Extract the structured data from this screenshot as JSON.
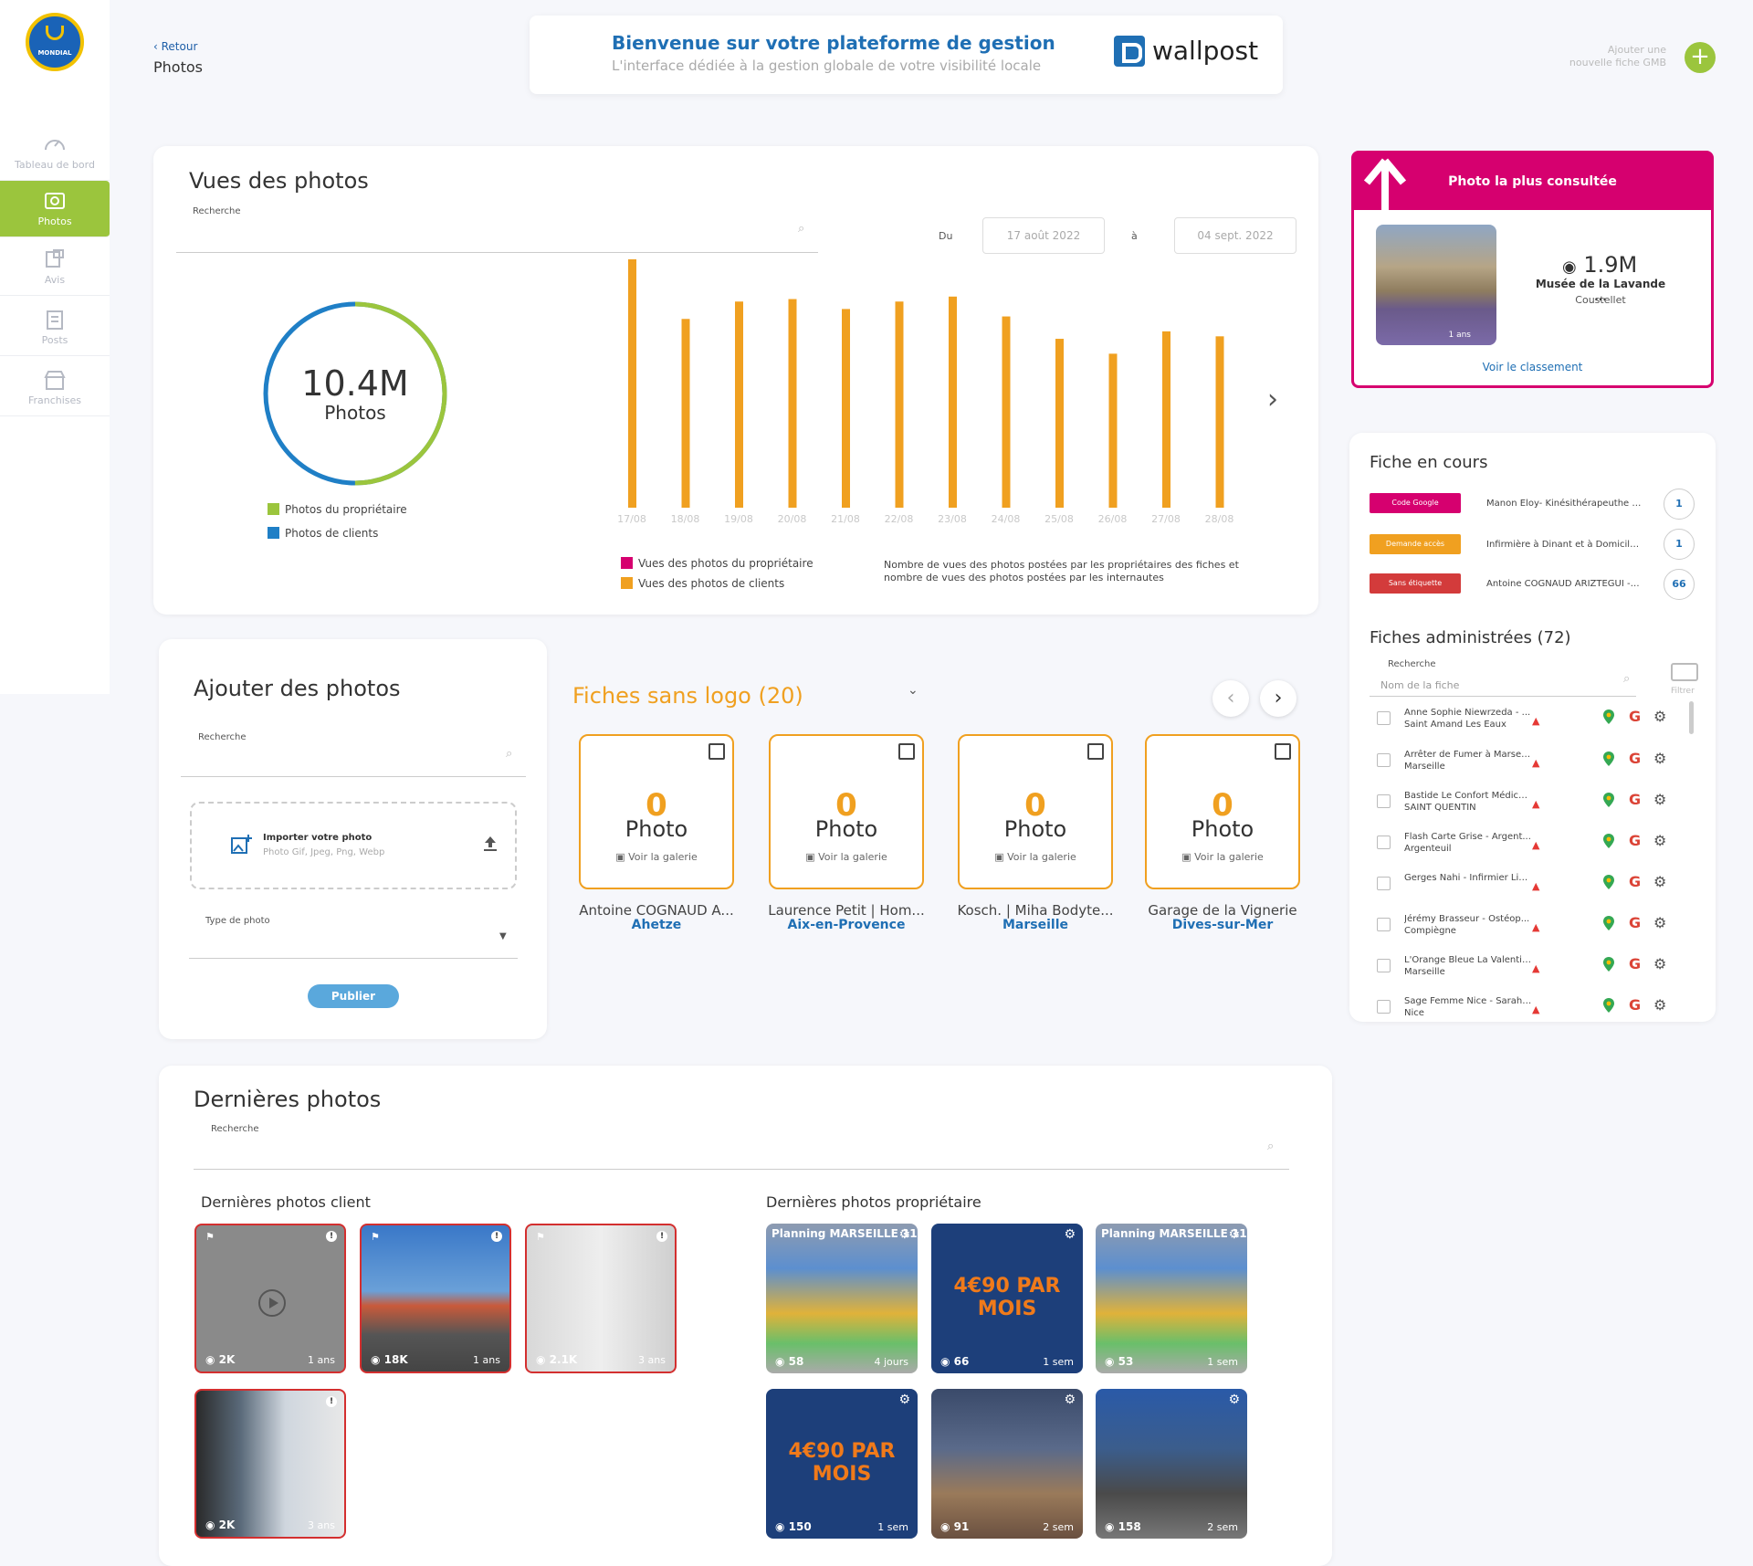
{
  "sidebar": {
    "logo_text": "MONDIAL",
    "items": [
      {
        "label": "Tableau de bord",
        "icon": "dashboard-icon",
        "active": false
      },
      {
        "label": "Photos",
        "icon": "photos-icon",
        "active": true
      },
      {
        "label": "Avis",
        "icon": "reviews-icon",
        "active": false
      },
      {
        "label": "Posts",
        "icon": "posts-icon",
        "active": false
      },
      {
        "label": "Franchises",
        "icon": "store-icon",
        "active": false
      }
    ]
  },
  "header": {
    "back_label": "Retour",
    "page_title": "Photos",
    "welcome_title": "Bienvenue sur votre plateforme de gestion",
    "welcome_subtitle": "L'interface dédiée à la gestion globale de votre visibilité locale",
    "brand": "wallpost",
    "add_fiche_line1": "Ajouter une",
    "add_fiche_line2": "nouvelle fiche GMB"
  },
  "vues": {
    "title": "Vues des photos",
    "search_label": "Recherche",
    "du_label": "Du",
    "a_label": "à",
    "date_from": "17 août 2022",
    "date_to": "04 sept. 2022",
    "total": "10.4M",
    "total_unit": "Photos",
    "donut_legend_owner": "Photos du propriétaire",
    "donut_legend_clients": "Photos de clients",
    "bar_legend_owner": "Vues des photos du propriétaire",
    "bar_legend_clients": "Vues des photos de clients",
    "description": "Nombre de vues des photos postées par les propriétaires des fiches et nombre de vues des photos postées par les internautes"
  },
  "chart_data": {
    "type": "bar",
    "categories": [
      "17/08",
      "18/08",
      "19/08",
      "20/08",
      "21/08",
      "22/08",
      "23/08",
      "24/08",
      "25/08",
      "26/08",
      "27/08",
      "28/08"
    ],
    "series": [
      {
        "name": "Vues des photos de clients",
        "values": [
          100,
          76,
          83,
          84,
          80,
          83,
          85,
          77,
          68,
          62,
          71,
          69
        ]
      }
    ],
    "ylim": [
      0,
      100
    ]
  },
  "donut": {
    "owner_fraction": 0.5,
    "owner_color": "#9bc53d",
    "clients_color": "#1f7fc6"
  },
  "colors": {
    "owner": "#d6006f",
    "clients": "#f0a020",
    "accent_green": "#9bc53d",
    "blue": "#1f6fb4"
  },
  "top_photo": {
    "title": "Photo la plus consultée",
    "views": "1.9M",
    "name": "Musée de la Lavande ...",
    "city": "Coustellet",
    "age": "1 ans",
    "link": "Voir le classement"
  },
  "fiche_en_cours": {
    "title": "Fiche en cours",
    "rows": [
      {
        "tag": "Code Google",
        "color": "#d6006f",
        "name": "Manon Eloy- Kinésithérapeuthe à ...",
        "count": "1"
      },
      {
        "tag": "Demande accès",
        "color": "#f0a020",
        "name": "Infirmière à Dinant et à Domicile -...",
        "count": "1"
      },
      {
        "tag": "Sans étiquette",
        "color": "#d33b3b",
        "name": "Antoine COGNAUD ARIZTEGUI - P...",
        "count": "66"
      }
    ]
  },
  "fiches_admin": {
    "title": "Fiches administrées (72)",
    "search_label": "Recherche",
    "search_placeholder": "Nom de la fiche",
    "filter_label": "Filtrer",
    "rows": [
      {
        "l1": "Anne Sophie Niewrzeda - ...",
        "l2": "Saint Amand Les Eaux"
      },
      {
        "l1": "Arrêter de Fumer à Marsei...",
        "l2": "Marseille"
      },
      {
        "l1": "Bastide Le Confort Médicale",
        "l2": "SAINT QUENTIN"
      },
      {
        "l1": "Flash Carte Grise - Argent...",
        "l2": "Argenteuil"
      },
      {
        "l1": "Gerges Nahi - Infirmier Lib...",
        "l2": ""
      },
      {
        "l1": "Jérémy Brasseur - Ostéop...",
        "l2": "Compiègne"
      },
      {
        "l1": "L'Orange Bleue La Valentine",
        "l2": "Marseille"
      },
      {
        "l1": "Sage Femme Nice - Sarah ...",
        "l2": "Nice"
      }
    ]
  },
  "ajouter": {
    "title": "Ajouter des photos",
    "search_label": "Recherche",
    "import_label": "Importer votre photo",
    "import_formats": "Photo Gif, Jpeg, Png, Webp",
    "type_label": "Type de photo",
    "publish_label": "Publier"
  },
  "sans_logo": {
    "title": "Fiches sans logo (20)",
    "cards": [
      {
        "count": "0",
        "unit": "Photo",
        "gallery": "Voir la galerie",
        "name": "Antoine COGNAUD A...",
        "city": "Ahetze"
      },
      {
        "count": "0",
        "unit": "Photo",
        "gallery": "Voir la galerie",
        "name": "Laurence Petit | Hom...",
        "city": "Aix-en-Provence"
      },
      {
        "count": "0",
        "unit": "Photo",
        "gallery": "Voir la galerie",
        "name": "Kosch. | Miha Bodyte...",
        "city": "Marseille"
      },
      {
        "count": "0",
        "unit": "Photo",
        "gallery": "Voir la galerie",
        "name": "Garage de la Vignerie",
        "city": "Dives-sur-Mer"
      }
    ]
  },
  "dernieres": {
    "title": "Dernières photos",
    "search_label": "Recherche",
    "client_title": "Dernières photos client",
    "owner_title": "Dernières photos propriétaire",
    "client_photos": [
      {
        "count": "2K",
        "age": "1 ans"
      },
      {
        "count": "18K",
        "age": "1 ans"
      },
      {
        "count": "2.1K",
        "age": "3 ans"
      },
      {
        "count": "2K",
        "age": "3 ans"
      }
    ],
    "owner_photos": [
      {
        "count": "58",
        "age": "4 jours",
        "caption": "Planning MARSEILLE 11"
      },
      {
        "count": "66",
        "age": "1 sem",
        "caption": "4€90 PAR MOIS"
      },
      {
        "count": "53",
        "age": "1 sem",
        "caption": "Planning MARSEILLE 11"
      },
      {
        "count": "150",
        "age": "1 sem",
        "caption": "4€90 PAR MOIS"
      },
      {
        "count": "91",
        "age": "2 sem",
        "caption": ""
      },
      {
        "count": "158",
        "age": "2 sem",
        "caption": ""
      }
    ]
  }
}
